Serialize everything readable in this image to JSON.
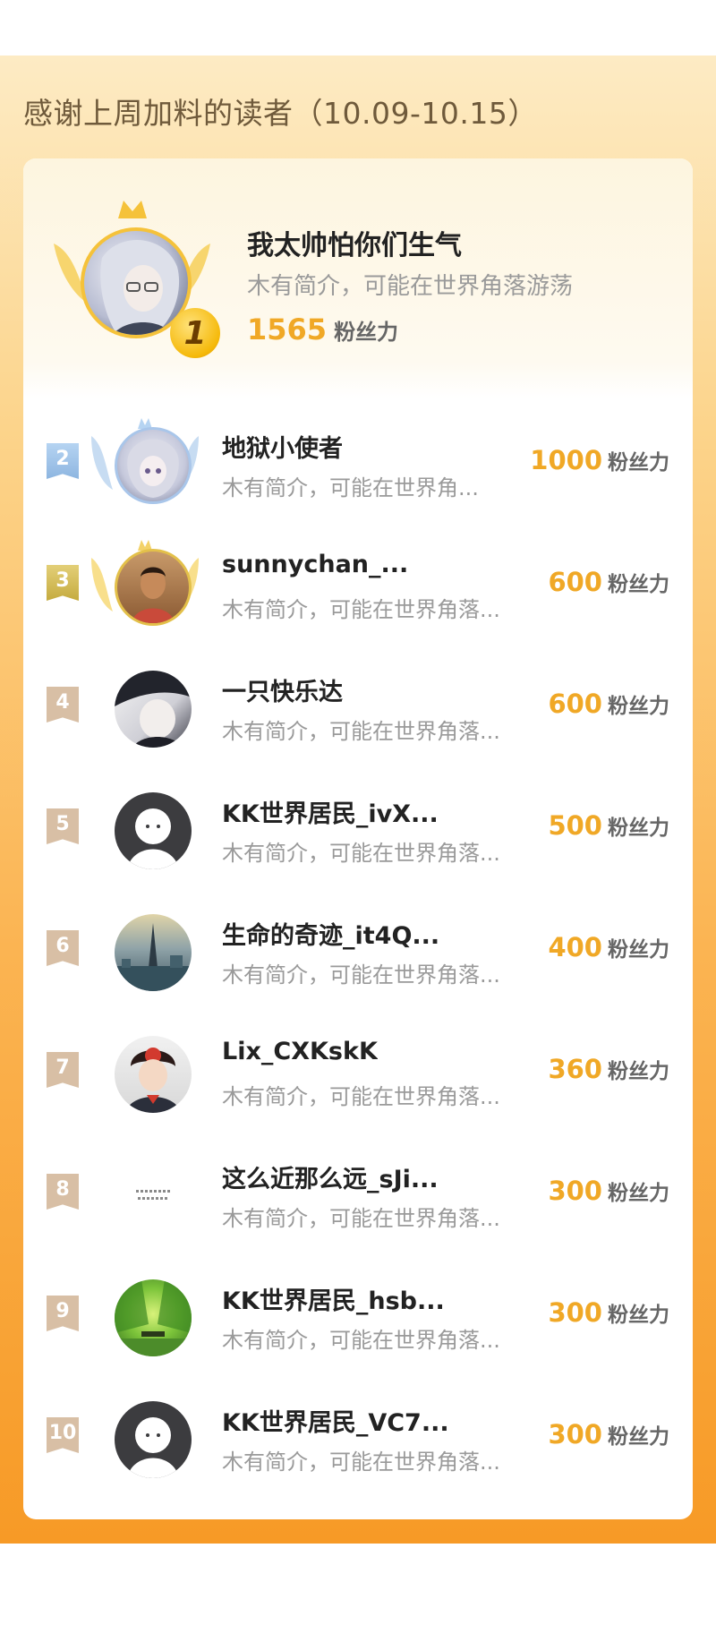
{
  "header": {
    "title": "感谢上周加料的读者（10.09-10.15）"
  },
  "top": {
    "rank": "1",
    "name": "我太帅怕你们生气",
    "bio": "木有简介，可能在世界角落游荡",
    "score": "1565",
    "unit": "粉丝力"
  },
  "list": [
    {
      "rank": "2",
      "name": "地狱小使者",
      "bio": "木有简介，可能在世界角...",
      "score": "1000",
      "unit": "粉丝力"
    },
    {
      "rank": "3",
      "name": "sunnychan_...",
      "bio": "木有简介，可能在世界角落...",
      "score": "600",
      "unit": "粉丝力"
    },
    {
      "rank": "4",
      "name": "一只快乐达",
      "bio": "木有简介，可能在世界角落...",
      "score": "600",
      "unit": "粉丝力"
    },
    {
      "rank": "5",
      "name": "KK世界居民_ivX...",
      "bio": "木有简介，可能在世界角落...",
      "score": "500",
      "unit": "粉丝力"
    },
    {
      "rank": "6",
      "name": "生命的奇迹_it4Q...",
      "bio": "木有简介，可能在世界角落...",
      "score": "400",
      "unit": "粉丝力"
    },
    {
      "rank": "7",
      "name": "Lix_CXKskK",
      "bio": "木有简介，可能在世界角落...",
      "score": "360",
      "unit": "粉丝力"
    },
    {
      "rank": "8",
      "name": "这么近那么远_sJi...",
      "bio": "木有简介，可能在世界角落...",
      "score": "300",
      "unit": "粉丝力"
    },
    {
      "rank": "9",
      "name": "KK世界居民_hsb...",
      "bio": "木有简介，可能在世界角落...",
      "score": "300",
      "unit": "粉丝力"
    },
    {
      "rank": "10",
      "name": "KK世界居民_VC7...",
      "bio": "木有简介，可能在世界角落...",
      "score": "300",
      "unit": "粉丝力"
    }
  ],
  "colors": {
    "accent": "#f0a826",
    "gold": "#f5c23a",
    "silver": "#8db5e0",
    "bronze": "#c5ab3f"
  }
}
